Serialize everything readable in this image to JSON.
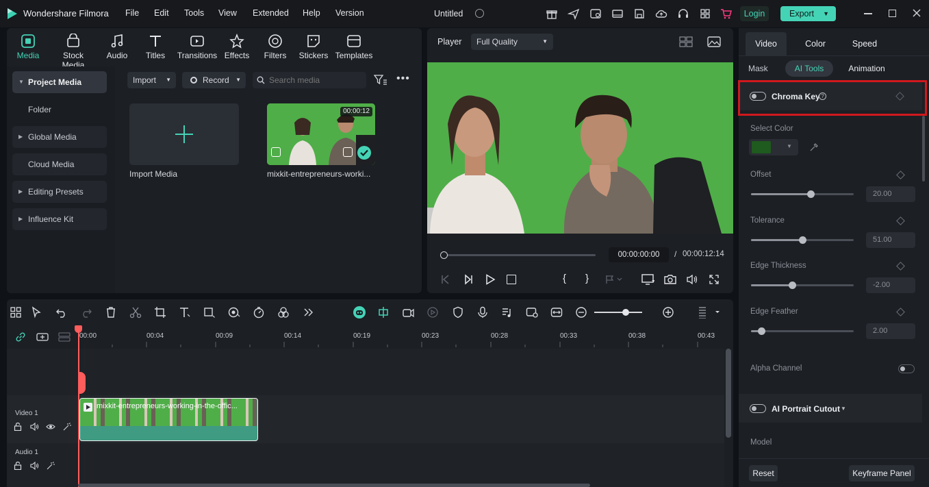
{
  "app": {
    "name": "Wondershare Filmora",
    "project_title": "Untitled"
  },
  "menu": [
    "File",
    "Edit",
    "Tools",
    "View",
    "Extended",
    "Help",
    "Version"
  ],
  "header": {
    "login_label": "Login",
    "export_label": "Export"
  },
  "media_tabs": [
    "Media",
    "Stock Media",
    "Audio",
    "Titles",
    "Transitions",
    "Effects",
    "Filters",
    "Stickers",
    "Templates"
  ],
  "sidebar": {
    "items": [
      {
        "label": "Project Media",
        "has_arrow": true
      },
      {
        "label": "Folder",
        "has_arrow": false
      },
      {
        "label": "Global Media",
        "has_arrow": true
      },
      {
        "label": "Cloud Media",
        "has_arrow": false
      },
      {
        "label": "Editing Presets",
        "has_arrow": true
      },
      {
        "label": "Influence Kit",
        "has_arrow": true
      }
    ]
  },
  "media_toolbar": {
    "import_label": "Import",
    "record_label": "Record",
    "search_placeholder": "Search media"
  },
  "media_items": [
    {
      "label": "Import Media"
    },
    {
      "label": "mixkit-entrepreneurs-worki...",
      "duration": "00:00:12"
    }
  ],
  "player": {
    "label": "Player",
    "quality": "Full Quality",
    "current_time": "00:00:00:00",
    "separator": "/",
    "total_time": "00:00:12:14",
    "progress": 0.0
  },
  "timeline": {
    "ruler": [
      "00:00",
      "00:04",
      "00:09",
      "00:14",
      "00:19",
      "00:23",
      "00:28",
      "00:33",
      "00:38",
      "00:43"
    ],
    "tracks": [
      {
        "label": "Video 1"
      },
      {
        "label": "Audio 1"
      }
    ],
    "clip_label": "mixkit-entrepreneurs-working-in-the-offic...",
    "zoom_level": 0.65
  },
  "right_panel": {
    "tabs": [
      "Video",
      "Color",
      "Speed"
    ],
    "subtabs": [
      "Mask",
      "AI Tools",
      "Animation"
    ],
    "chroma_key_label": "Chroma Key",
    "select_color_label": "Select Color",
    "key_color": "#1f5a1e",
    "properties": [
      {
        "label": "Offset",
        "value": "20.00",
        "fraction": 0.58
      },
      {
        "label": "Tolerance",
        "value": "51.00",
        "fraction": 0.5
      },
      {
        "label": "Edge Thickness",
        "value": "-2.00",
        "fraction": 0.4
      },
      {
        "label": "Edge Feather",
        "value": "2.00",
        "fraction": 0.1
      }
    ],
    "alpha_channel_label": "Alpha Channel",
    "portrait_cutout_label": "AI Portrait Cutout",
    "model_label": "Model",
    "reset_label": "Reset",
    "keyframe_label": "Keyframe Panel"
  },
  "colors": {
    "accent": "#45d3b6",
    "highlight_box": "#d0181d",
    "green_screen": "#4fae48"
  }
}
